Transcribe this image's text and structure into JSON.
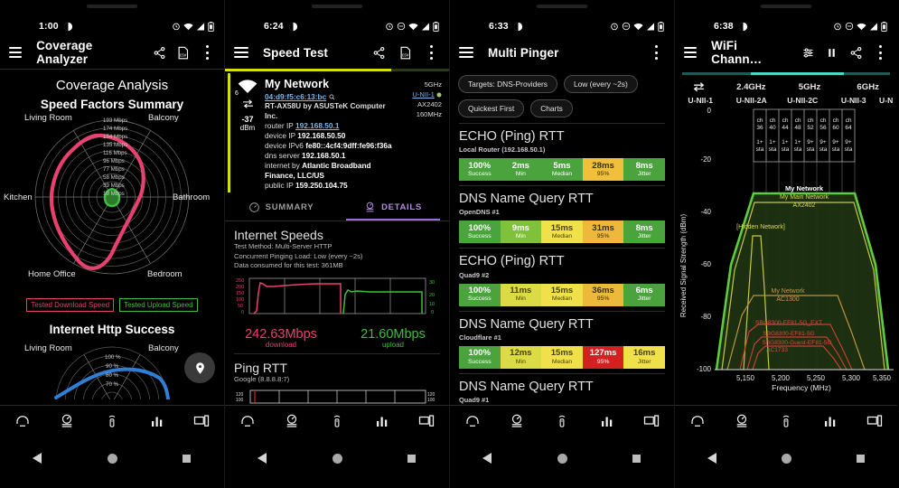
{
  "panel1": {
    "status": {
      "time": "1:00"
    },
    "appbar": {
      "title": "Coverage Analyzer"
    },
    "headings": {
      "h1": "Coverage Analysis",
      "h2": "Speed Factors Summary",
      "h3": "Internet Http Success"
    },
    "radar": {
      "axes": [
        "Living Room",
        "Balcony",
        "Bathroom",
        "Bedroom",
        "Home Office",
        "Kitchen"
      ],
      "scale_labels": [
        "193 Mbps",
        "174 Mbps",
        "154 Mbps",
        "135 Mbps",
        "116 Mbps",
        "96 Mbps",
        "77 Mbps",
        "58 Mbps",
        "39 Mbps",
        "19 Mbps"
      ],
      "legend": [
        {
          "label": "Tested Download Speed",
          "color": "#e8416f"
        },
        {
          "label": "Tested Upload Speed",
          "color": "#3fbf3f"
        }
      ]
    },
    "radar2": {
      "axes": [
        "Living Room",
        "Balcony"
      ],
      "scale_labels": [
        "100 %",
        "90 %",
        "80 %",
        "70 %"
      ],
      "series_color": "#2f7fd6"
    },
    "fab": "location-pin"
  },
  "panel2": {
    "status": {
      "time": "6:24"
    },
    "appbar": {
      "title": "Speed Test"
    },
    "network": {
      "name": "My Network",
      "mac": "04:d9:f5:c6:13:bc",
      "vendor": "RT-AX58U by ASUSTeK Computer Inc.",
      "router_ip_label": "router IP",
      "router_ip": "192.168.50.1",
      "device_ip_label": "device IP",
      "device_ip": "192.168.50.50",
      "device_ipv6_label": "device IPv6",
      "device_ipv6": "fe80::4cf4:9dff:fe96:f36a",
      "dns_label": "dns server",
      "dns": "192.168.50.1",
      "internet_label": "internet by",
      "internet": "Atlantic Broadband Finance, LLC/US",
      "public_ip_label": "public IP",
      "public_ip": "159.250.104.75",
      "signal_dbm": "-37",
      "signal_unit": "dBm",
      "signal_bars": "6",
      "right": {
        "band": "5GHz",
        "unii": "U-NII-1",
        "phy": "AX2402",
        "width": "160MHz"
      }
    },
    "tabs": [
      {
        "label": "SUMMARY",
        "active": false
      },
      {
        "label": "DETAILS",
        "active": true
      }
    ],
    "internet_speeds": {
      "title": "Internet Speeds",
      "lines": [
        "Test Method: Multi-Server HTTP",
        "Concurrent Pinging Load: Low (every ~2s)",
        "Data consumed for this test: 361MB"
      ],
      "download_value": "242.63Mbps",
      "download_label": "download",
      "upload_value": "21.60Mbps",
      "upload_label": "upload"
    },
    "ping_rtt": {
      "title": "Ping RTT",
      "sub": "Google (8.8.8.8:7)",
      "y_left": [
        "120",
        "100"
      ],
      "y_right": [
        "120",
        "100"
      ]
    }
  },
  "panel3": {
    "status": {
      "time": "6:33"
    },
    "appbar": {
      "title": "Multi Pinger"
    },
    "chips": [
      "Targets: DNS-Providers",
      "Low (every ~2s)",
      "Quickest First",
      "Charts"
    ],
    "blocks": [
      {
        "title": "ECHO (Ping) RTT",
        "sub": "Local Router (192.168.50.1)",
        "cells": [
          {
            "value": "100%",
            "label": "Success",
            "bg": "#4aa33c",
            "fg": "#ffffff"
          },
          {
            "value": "2ms",
            "label": "Min",
            "bg": "#4aa33c",
            "fg": "#ffffff"
          },
          {
            "value": "5ms",
            "label": "Median",
            "bg": "#4aa33c",
            "fg": "#ffffff"
          },
          {
            "value": "28ms",
            "label": "95%",
            "bg": "#f0c03a",
            "fg": "#333300"
          },
          {
            "value": "8ms",
            "label": "Jitter",
            "bg": "#4aa33c",
            "fg": "#ffffff"
          }
        ]
      },
      {
        "title": "DNS Name Query RTT",
        "sub": "OpenDNS #1",
        "cells": [
          {
            "value": "100%",
            "label": "Success",
            "bg": "#4aa33c",
            "fg": "#ffffff"
          },
          {
            "value": "9ms",
            "label": "Min",
            "bg": "#7fc13a",
            "fg": "#ffffff"
          },
          {
            "value": "15ms",
            "label": "Median",
            "bg": "#f0e04a",
            "fg": "#4a4400"
          },
          {
            "value": "31ms",
            "label": "95%",
            "bg": "#eeb93a",
            "fg": "#3a2e00"
          },
          {
            "value": "8ms",
            "label": "Jitter",
            "bg": "#4aa33c",
            "fg": "#ffffff"
          }
        ]
      },
      {
        "title": "ECHO (Ping) RTT",
        "sub": "Quad9 #2",
        "cells": [
          {
            "value": "100%",
            "label": "Success",
            "bg": "#4aa33c",
            "fg": "#ffffff"
          },
          {
            "value": "11ms",
            "label": "Min",
            "bg": "#dbdb45",
            "fg": "#4a4400"
          },
          {
            "value": "15ms",
            "label": "Median",
            "bg": "#f0e04a",
            "fg": "#4a4400"
          },
          {
            "value": "36ms",
            "label": "95%",
            "bg": "#eeb93a",
            "fg": "#3a2e00"
          },
          {
            "value": "6ms",
            "label": "Jitter",
            "bg": "#4aa33c",
            "fg": "#ffffff"
          }
        ]
      },
      {
        "title": "DNS Name Query RTT",
        "sub": "Cloudflare #1",
        "cells": [
          {
            "value": "100%",
            "label": "Success",
            "bg": "#4aa33c",
            "fg": "#ffffff"
          },
          {
            "value": "12ms",
            "label": "Min",
            "bg": "#dbdb45",
            "fg": "#4a4400"
          },
          {
            "value": "15ms",
            "label": "Median",
            "bg": "#f0e04a",
            "fg": "#4a4400"
          },
          {
            "value": "127ms",
            "label": "95%",
            "bg": "#d32020",
            "fg": "#ffffff"
          },
          {
            "value": "16ms",
            "label": "Jitter",
            "bg": "#f0e04a",
            "fg": "#4a4400"
          }
        ]
      },
      {
        "title": "DNS Name Query RTT",
        "sub": "Quad9 #1",
        "cells": []
      }
    ]
  },
  "panel4": {
    "status": {
      "time": "6:38"
    },
    "appbar": {
      "title": "WiFi Chann…"
    },
    "bands": [
      "2.4GHz",
      "5GHz",
      "6GHz"
    ],
    "unii": [
      "U-NII-1",
      "U-NII-2A",
      "U-NII-2C",
      "U-NII-3",
      "U-N"
    ],
    "chart_data": {
      "type": "area",
      "title": "WiFi Channels",
      "xlabel": "Frequency (MHz)",
      "ylabel": "Received Signal Strength (dBm)",
      "xticks": [
        "5,150",
        "5,200",
        "5,250",
        "5,300",
        "5,350"
      ],
      "yticks": [
        "0",
        "-20",
        "-40",
        "-60",
        "-80",
        "-100"
      ],
      "ylim": [
        -100,
        0
      ],
      "xlim": [
        5130,
        5365
      ],
      "grid": true,
      "legend": "inline-labels",
      "channels": [
        {
          "ch": "ch 36",
          "sta": "1+ sta"
        },
        {
          "ch": "ch 40",
          "sta": "1+ sta"
        },
        {
          "ch": "ch 44",
          "sta": "1+ sta"
        },
        {
          "ch": "ch 48",
          "sta": "1+ sta"
        },
        {
          "ch": "ch 52",
          "sta": "9+ sta"
        },
        {
          "ch": "ch 56",
          "sta": "9+ sta"
        },
        {
          "ch": "ch 60",
          "sta": "9+ sta"
        },
        {
          "ch": "ch 64",
          "sta": "9+ sta"
        }
      ],
      "networks": [
        {
          "name": "My Network",
          "phy": "AX2402",
          "peak_dbm": -32,
          "color": "#5fcc3f",
          "label_color": "#ffffff"
        },
        {
          "name": "My Main Network",
          "phy": "AX2402",
          "peak_dbm": -35,
          "color": "#c8c840",
          "label_color": "#d8d850"
        },
        {
          "name": "[Hidden Network]",
          "phy": "",
          "peak_dbm": -47,
          "color": "#c8c840",
          "label_color": "#d8d850"
        },
        {
          "name": "My Network",
          "phy": "AC1300",
          "peak_dbm": -70,
          "color": "#c09040",
          "label_color": "#d09050"
        },
        {
          "name": "SBG8300-EF81-5G_EXT",
          "phy": "",
          "peak_dbm": -83,
          "color": "#c04030",
          "label_color": "#d05040"
        },
        {
          "name": "SBG8300-EF81-5G",
          "phy": "",
          "peak_dbm": -86,
          "color": "#c04030",
          "label_color": "#d05040"
        },
        {
          "name": "SBG8300-Guest-EF81-5G",
          "phy": "AC1733",
          "peak_dbm": -88,
          "color": "#c04030",
          "label_color": "#d05040"
        }
      ]
    }
  },
  "botnav": {
    "items": [
      "coverage-icon",
      "speed-test-icon",
      "signal-icon",
      "channels-icon",
      "devices-icon"
    ]
  },
  "sysnav": {
    "items": [
      "back-button",
      "home-button",
      "recents-button"
    ]
  }
}
